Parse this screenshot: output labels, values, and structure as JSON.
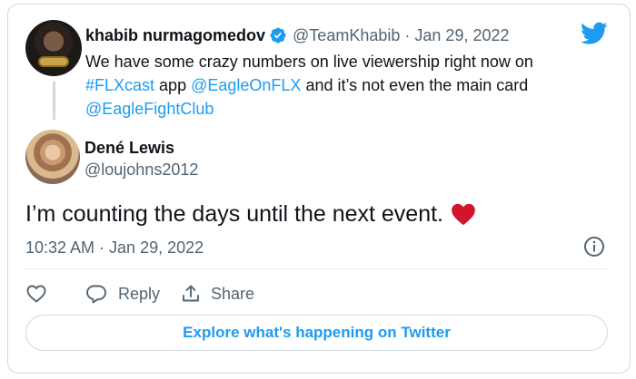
{
  "quoted_tweet": {
    "author_name": "khabib nurmagomedov",
    "verified": true,
    "handle": "@TeamKhabib",
    "separator": "·",
    "date": "Jan 29, 2022",
    "text_line1": "We have some crazy numbers on live viewership right now on",
    "hashtag": "#FLXcast",
    "text_mid": " app ",
    "mention1": "@EagleOnFLX",
    "text_after": " and it’s not even the main card",
    "mention2": "@EagleFightClub",
    "avatar_icon": "profile-photo-fighter-with-belt"
  },
  "tweet": {
    "author_name": "Dené Lewis",
    "handle": "@loujohns2012",
    "text": "I’m counting the days until the next event.",
    "emoji_icon": "red-heart-emoji",
    "timestamp": "10:32 AM · Jan 29, 2022",
    "avatar_icon": "profile-photo-woman"
  },
  "actions": {
    "like_icon": "heart-outline-icon",
    "reply_label": "Reply",
    "reply_icon": "speech-bubble-icon",
    "share_label": "Share",
    "share_icon": "share-upload-icon"
  },
  "explore_label": "Explore what's happening on Twitter",
  "colors": {
    "accent": "#1d9bf0",
    "text": "#0f1419",
    "muted": "#536471",
    "border": "#cfd9de",
    "heart": "#d3152b"
  }
}
